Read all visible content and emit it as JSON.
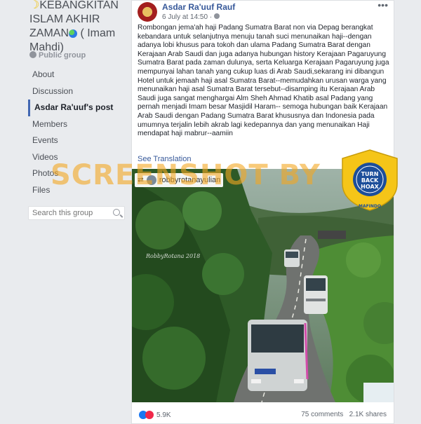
{
  "group": {
    "title": "KEBANGKITAN ISLAM AKHIR ZAMAN ( Imam Mahdi)",
    "title_line1": "KEBANGKITAN",
    "title_line2": "ISLAM AKHIR",
    "title_line3": "ZAMAN",
    "title_line3b": " ( Imam",
    "title_line4": "Mahdi)",
    "privacy": "Public group"
  },
  "nav": {
    "items": [
      {
        "label": "About"
      },
      {
        "label": "Discussion"
      },
      {
        "label": "Asdar Ra'uuf's post",
        "active": true
      },
      {
        "label": "Members"
      },
      {
        "label": "Events"
      },
      {
        "label": "Videos"
      },
      {
        "label": "Photos"
      },
      {
        "label": "Files"
      }
    ]
  },
  "search": {
    "placeholder": "Search this group"
  },
  "post": {
    "author": "Asdar Ra'uuf Rauf",
    "time": "6 July at 14:50",
    "text": "Rombongan jema'ah haji Padang Sumatra Barat non via Depag berangkat kebandara untuk selanjutnya menuju tanah suci menunaikan haji--dengan adanya lobi khusus para tokoh dan ulama Padang Sumatra Barat dengan Kerajaan Arab Saudi dan juga adanya hubungan history Kerajaan Pagaruyung Sumatra Barat pada zaman dulunya, serta Keluarga Kerajaan Pagaruyung juga mempunyai lahan tanah yang cukup luas di Arab Saudi,sekarang ini dibangun Hotel untuk jemaah haji asal Sumatra Barat--memudahkan urusan warga yang menunaikan haji asal Sumatra Barat tersebut--disamping itu Kerajaan Arab Saudi juga sangat menghargai Alm Sheh Ahmad Khatib asal Padang yang pernah menjadi Imam besar Masjidil Haram-- semoga hubungan baik Kerajaan Arab Saudi dengan Padang Sumatra Barat khususnya dan Indonesia pada umumnya terjalin lebih akrab lagi kedepannya dan yang menunaikan Haji mendapat haji mabrur--aamiin",
    "see_translation": "See Translation",
    "repost_user": "robbyrotanayulian",
    "photo_signature": "RobbyRotana 2018",
    "reaction_count": "5.9K",
    "comments": "75 comments",
    "shares": "2.1K shares"
  },
  "overlay": {
    "screenshot_label": "SCREENSHOT BY",
    "badge_top": "TURN",
    "badge_mid": "BACK",
    "badge_bottom": "HOAX",
    "badge_ring_top": "MASYARAKAT ANTI FITNAH INDONESIA",
    "badge_ring_bottom": "MAFINDO"
  },
  "colors": {
    "link": "#365899",
    "background": "#e9ebee",
    "overlay_orange": "#f3a622",
    "badge_yellow": "#f5c518",
    "badge_blue": "#1c4e9a"
  }
}
